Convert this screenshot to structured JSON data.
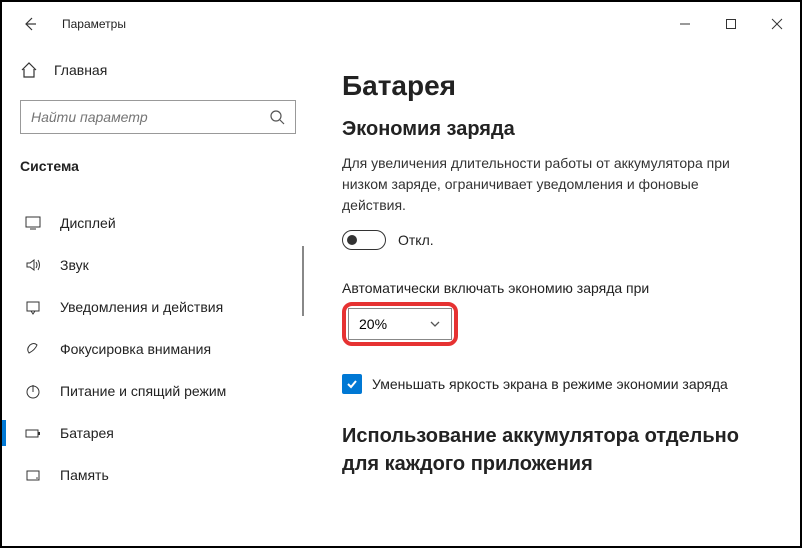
{
  "window": {
    "title": "Параметры"
  },
  "sidebar": {
    "home": "Главная",
    "search_placeholder": "Найти параметр",
    "category": "Система",
    "items": [
      {
        "label": "Дисплей"
      },
      {
        "label": "Звук"
      },
      {
        "label": "Уведомления и действия"
      },
      {
        "label": "Фокусировка внимания"
      },
      {
        "label": "Питание и спящий режим"
      },
      {
        "label": "Батарея"
      },
      {
        "label": "Память"
      }
    ]
  },
  "content": {
    "h1": "Батарея",
    "h2": "Экономия заряда",
    "description": "Для увеличения длительности работы от аккумулятора при низком заряде, ограничивает уведомления и фоновые действия.",
    "toggle_state": "Откл.",
    "auto_on_label": "Автоматически включать экономию заряда при",
    "threshold_value": "20%",
    "reduce_brightness": "Уменьшать яркость экрана в режиме экономии заряда",
    "usage_heading": "Использование аккумулятора отдельно для каждого приложения"
  }
}
